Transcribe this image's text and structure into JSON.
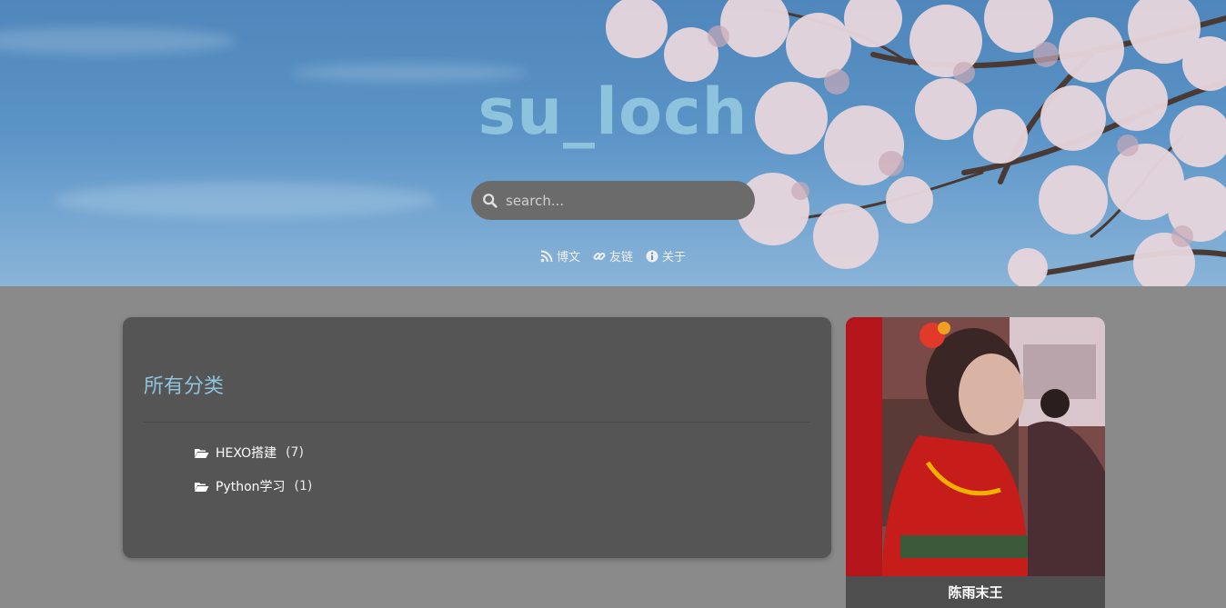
{
  "header": {
    "site_title": "su_loch",
    "search": {
      "placeholder": "search..."
    },
    "nav": [
      {
        "label": "博文",
        "icon": "rss-icon"
      },
      {
        "label": "友链",
        "icon": "link-icon"
      },
      {
        "label": "关于",
        "icon": "info-icon"
      }
    ]
  },
  "categories_card": {
    "title": "所有分类",
    "items": [
      {
        "name": "HEXO搭建",
        "count": "(7)",
        "icon": "folder-open-icon"
      },
      {
        "name": "Python学习",
        "count": "(1)",
        "icon": "folder-open-icon"
      }
    ]
  },
  "profile": {
    "name": "陈雨末王"
  },
  "colors": {
    "title": "#8ec3dd",
    "page_bg": "#8a8a8a",
    "card_bg": "#555555",
    "search_bg": "#6b6b6b"
  }
}
